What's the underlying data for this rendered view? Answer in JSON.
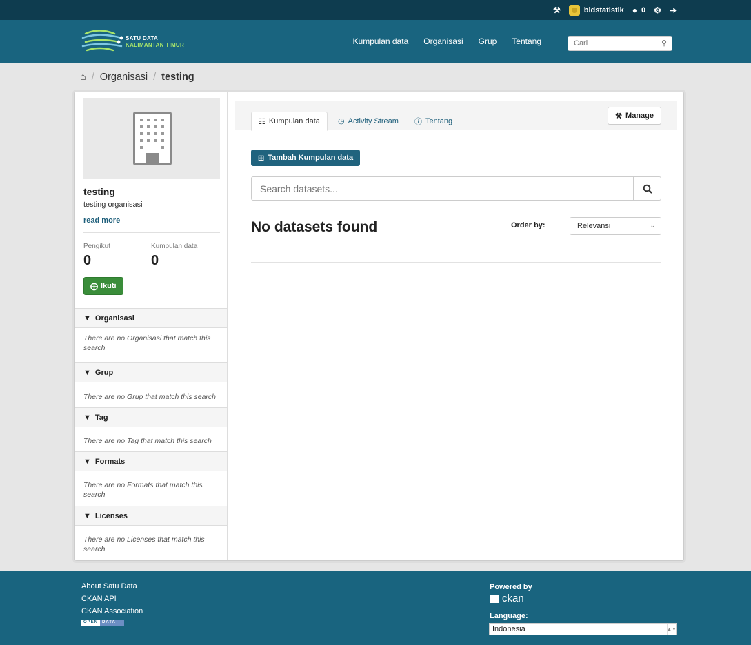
{
  "account": {
    "username": "bidstatistik",
    "notifications": "0",
    "icons": [
      "sysadmin-icon",
      "dashboard-icon",
      "settings-icon",
      "logout-icon"
    ]
  },
  "header": {
    "logo_line1": "SATU DATA",
    "logo_line2": "KALIMANTAN TIMUR",
    "nav": [
      "Kumpulan data",
      "Organisasi",
      "Grup",
      "Tentang"
    ],
    "search_placeholder": "Cari"
  },
  "breadcrumb": {
    "home_icon": "home-icon",
    "items": [
      "Organisasi",
      "testing"
    ]
  },
  "org": {
    "title": "testing",
    "description": "testing organisasi",
    "read_more": "read more",
    "followers_label": "Pengikut",
    "followers_value": "0",
    "datasets_label": "Kumpulan data",
    "datasets_value": "0",
    "follow_label": "Ikuti"
  },
  "facets": [
    {
      "title": "Organisasi",
      "empty": "There are no Organisasi that match this search"
    },
    {
      "title": "Grup",
      "empty": "There are no Grup that match this search"
    },
    {
      "title": "Tag",
      "empty": "There are no Tag that match this search"
    },
    {
      "title": "Formats",
      "empty": "There are no Formats that match this search"
    },
    {
      "title": "Licenses",
      "empty": "There are no Licenses that match this search"
    }
  ],
  "main": {
    "tabs": [
      {
        "label": "Kumpulan data",
        "icon": "sitemap-icon"
      },
      {
        "label": "Activity Stream",
        "icon": "clock-icon"
      },
      {
        "label": "Tentang",
        "icon": "info-icon"
      }
    ],
    "manage_label": "Manage",
    "add_label": "Tambah Kumpulan data",
    "search_placeholder": "Search datasets...",
    "no_results": "No datasets found",
    "order_label": "Order by:",
    "order_value": "Relevansi"
  },
  "footer": {
    "links": [
      "About Satu Data",
      "CKAN API",
      "CKAN Association"
    ],
    "open_data_a": "OPEN",
    "open_data_b": "DATA",
    "powered_by": "Powered by",
    "ckan": "ckan",
    "language_label": "Language:",
    "language_value": "Indonesia"
  },
  "colors": {
    "top_bar": "#0e3c4f",
    "masthead": "#19647f",
    "accent": "#20637e",
    "follow": "#3a8d3a"
  }
}
